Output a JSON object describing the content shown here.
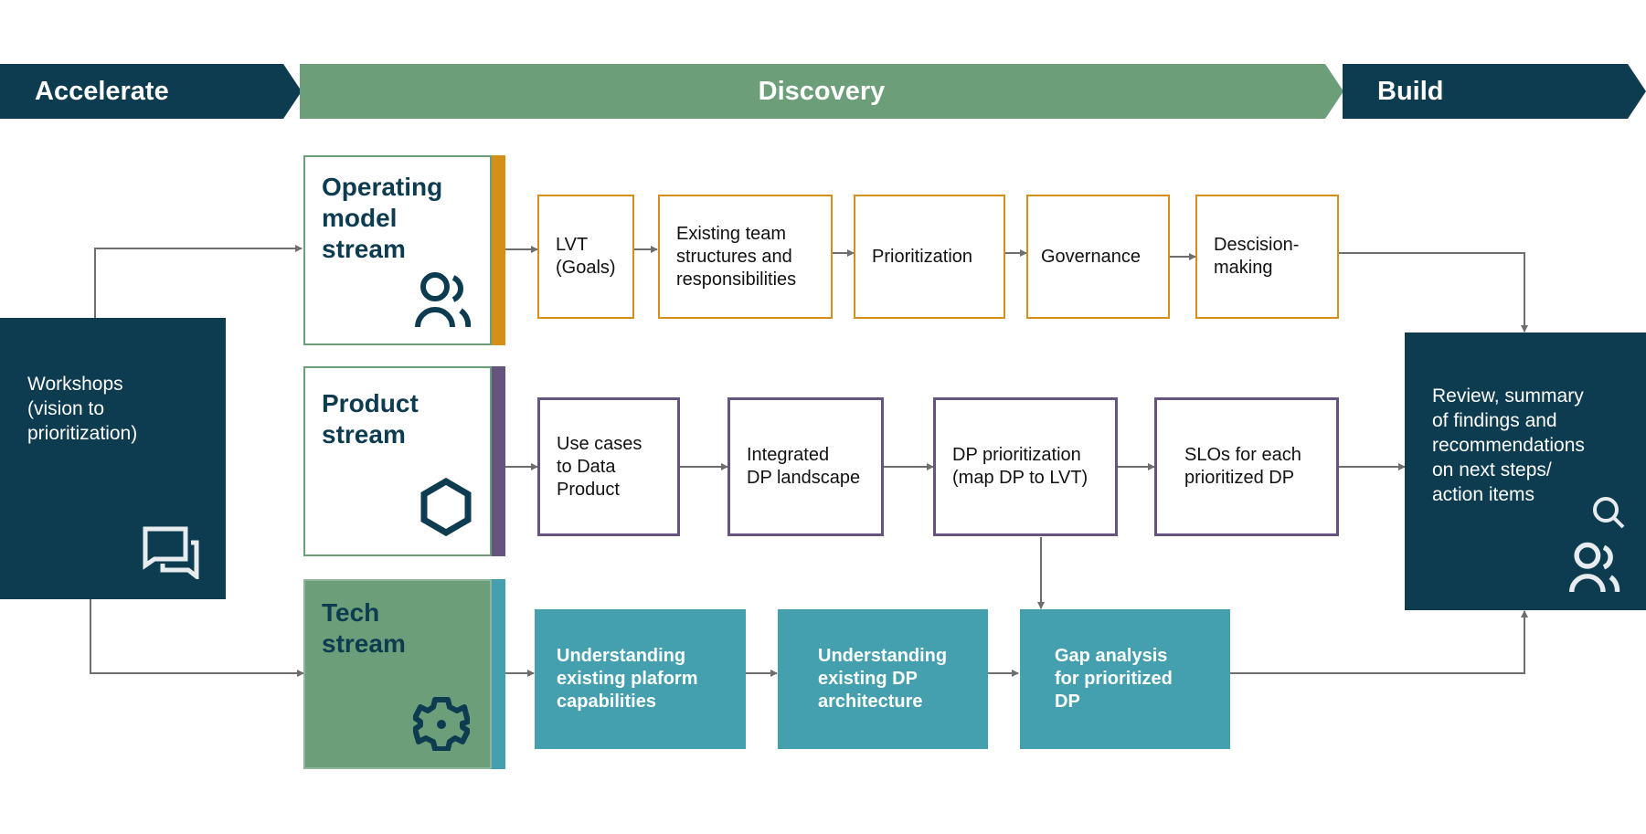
{
  "phases": {
    "accelerate": "Accelerate",
    "discovery": "Discovery",
    "build": "Build"
  },
  "colors": {
    "dark_teal": "#0d3b50",
    "green": "#6b9e79",
    "operating_accent": "#d38f17",
    "product_accent": "#65547e",
    "tech_accent": "#44a0ae",
    "connector": "#6e6e6e"
  },
  "workshops": {
    "label": "Workshops\n(vision to\nprioritization)",
    "icon": "chat-bubbles-icon"
  },
  "streams": {
    "operating": {
      "title": "Operating\nmodel\nstream",
      "icon": "people-icon",
      "steps": [
        "LVT\n(Goals)",
        "Existing team\nstructures and\nresponsibilities",
        "Prioritization",
        "Governance",
        "Descision-\nmaking"
      ]
    },
    "product": {
      "title": "Product\nstream",
      "icon": "hexagon-icon",
      "steps": [
        "Use cases\nto Data\nProduct",
        "Integrated\nDP landscape",
        "DP prioritization\n(map DP to LVT)",
        "SLOs for each\nprioritized DP"
      ]
    },
    "tech": {
      "title": "Tech\nstream",
      "icon": "gear-icon",
      "steps": [
        "Understanding\nexisting plaform\ncapabilities",
        "Understanding\nexisting DP\narchitecture",
        "Gap analysis\nfor prioritized\nDP"
      ]
    }
  },
  "review": {
    "label": "Review, summary\nof findings and\nrecommendations\non next steps/\naction items",
    "icons": [
      "search-icon",
      "people-icon"
    ]
  }
}
